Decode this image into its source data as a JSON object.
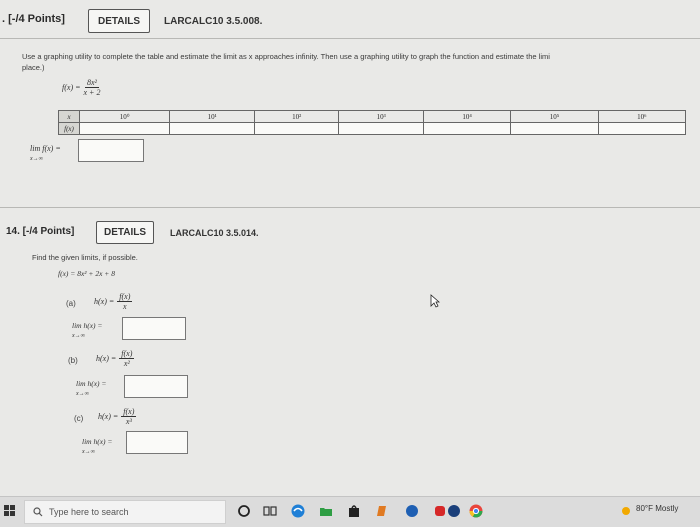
{
  "q13": {
    "points": ". [-/4 Points]",
    "details": "DETAILS",
    "code": "LARCALC10 3.5.008.",
    "instruction_line1": "Use a graphing utility to complete the table and estimate the limit as x approaches infinity. Then use a graphing utility to graph the function and estimate the limi",
    "instruction_line2": "place.)",
    "func_lhs": "f(x) =",
    "func_num": "8x²",
    "func_den": "x + 2",
    "table": {
      "x_label": "x",
      "f_label": "f(x)",
      "x_values": [
        "10⁰",
        "10¹",
        "10²",
        "10³",
        "10⁴",
        "10⁵",
        "10⁶"
      ]
    },
    "limit_label": "lim f(x) =",
    "limit_sub": "x→∞"
  },
  "q14": {
    "points": "14. [-/4 Points]",
    "details": "DETAILS",
    "code": "LARCALC10 3.5.014.",
    "instruction": "Find the given limits, if possible.",
    "func": "f(x) = 8x² + 2x + 8",
    "parts": [
      {
        "letter": "(a)",
        "lhs": "h(x) =",
        "num": "f(x)",
        "den": "x",
        "limit": "lim h(x) =",
        "sub": "x→∞"
      },
      {
        "letter": "(b)",
        "lhs": "h(x) =",
        "num": "f(x)",
        "den": "x²",
        "limit": "lim h(x) =",
        "sub": "x→∞"
      },
      {
        "letter": "(c)",
        "lhs": "h(x) =",
        "num": "f(x)",
        "den": "x³",
        "limit": "lim h(x) =",
        "sub": "x→∞"
      }
    ]
  },
  "taskbar": {
    "search_placeholder": "Type here to search",
    "weather": "80°F  Mostly"
  },
  "colors": {
    "page_bg": "#e9e9e7",
    "taskbar_bg": "#dcdcdc",
    "edge_blue": "#1f7fd6"
  }
}
